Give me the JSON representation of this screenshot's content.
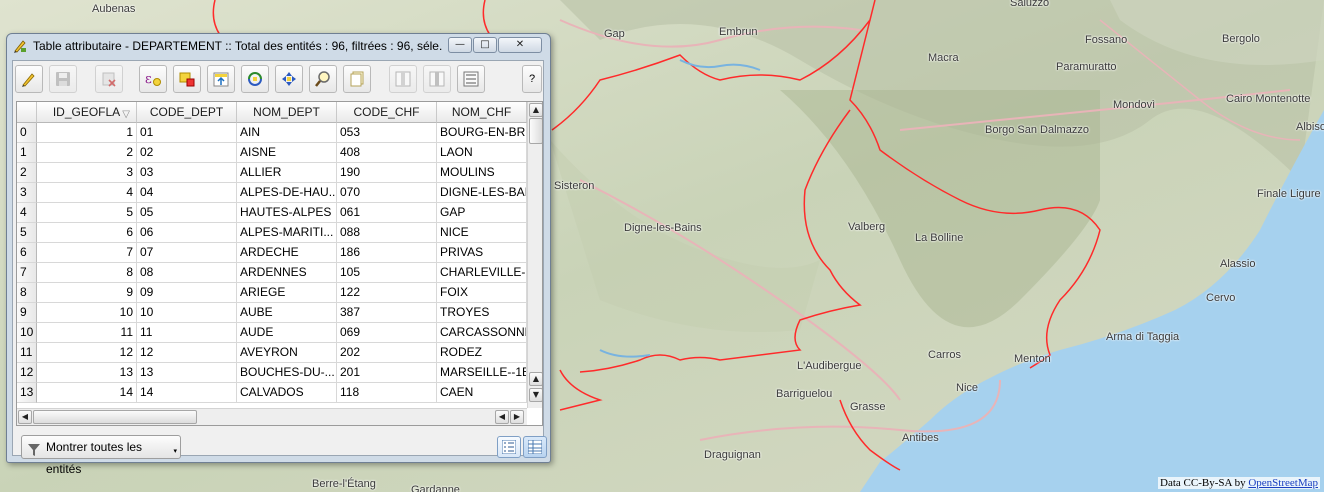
{
  "window": {
    "title": "Table attributaire - DEPARTEMENT :: Total des entités : 96, filtrées : 96, séle...",
    "controls": {
      "minimize": "—",
      "maximize": "□",
      "close": "✕"
    }
  },
  "toolbar": {
    "buttons": [
      "edit-pencil-icon",
      "save-icon",
      "delete-icon",
      "expression-select-icon",
      "deselect-icon",
      "move-selection-top-icon",
      "invert-selection-icon",
      "pan-to-selection-icon",
      "zoom-to-selection-icon",
      "copy-icon",
      "new-field-icon",
      "delete-field-icon",
      "field-calculator-icon"
    ],
    "help_label": "?"
  },
  "table": {
    "columns": [
      "ID_GEOFLA",
      "CODE_DEPT",
      "NOM_DEPT",
      "CODE_CHF",
      "NOM_CHF"
    ],
    "sort_indicator": "▽",
    "rows": [
      {
        "idx": "0",
        "id": "1",
        "code": "01",
        "nom": "AIN",
        "chf": "053",
        "nomchf": "BOURG-EN-BR..."
      },
      {
        "idx": "1",
        "id": "2",
        "code": "02",
        "nom": "AISNE",
        "chf": "408",
        "nomchf": "LAON"
      },
      {
        "idx": "2",
        "id": "3",
        "code": "03",
        "nom": "ALLIER",
        "chf": "190",
        "nomchf": "MOULINS"
      },
      {
        "idx": "3",
        "id": "4",
        "code": "04",
        "nom": "ALPES-DE-HAU...",
        "chf": "070",
        "nomchf": "DIGNE-LES-BAI..."
      },
      {
        "idx": "4",
        "id": "5",
        "code": "05",
        "nom": "HAUTES-ALPES",
        "chf": "061",
        "nomchf": "GAP"
      },
      {
        "idx": "5",
        "id": "6",
        "code": "06",
        "nom": "ALPES-MARITI...",
        "chf": "088",
        "nomchf": "NICE"
      },
      {
        "idx": "6",
        "id": "7",
        "code": "07",
        "nom": "ARDECHE",
        "chf": "186",
        "nomchf": "PRIVAS"
      },
      {
        "idx": "7",
        "id": "8",
        "code": "08",
        "nom": "ARDENNES",
        "chf": "105",
        "nomchf": "CHARLEVILLE-..."
      },
      {
        "idx": "8",
        "id": "9",
        "code": "09",
        "nom": "ARIEGE",
        "chf": "122",
        "nomchf": "FOIX"
      },
      {
        "idx": "9",
        "id": "10",
        "code": "10",
        "nom": "AUBE",
        "chf": "387",
        "nomchf": "TROYES"
      },
      {
        "idx": "10",
        "id": "11",
        "code": "11",
        "nom": "AUDE",
        "chf": "069",
        "nomchf": "CARCASSONNE"
      },
      {
        "idx": "11",
        "id": "12",
        "code": "12",
        "nom": "AVEYRON",
        "chf": "202",
        "nomchf": "RODEZ"
      },
      {
        "idx": "12",
        "id": "13",
        "code": "13",
        "nom": "BOUCHES-DU-...",
        "chf": "201",
        "nomchf": "MARSEILLE--1E..."
      },
      {
        "idx": "13",
        "id": "14",
        "code": "14",
        "nom": "CALVADOS",
        "chf": "118",
        "nomchf": "CAEN"
      }
    ]
  },
  "scroll": {
    "up": "▲",
    "down": "▼",
    "left": "◀",
    "right": "▶"
  },
  "bottom": {
    "filter_label": "Montrer toutes les entités",
    "caret": "▾"
  },
  "map": {
    "places": [
      {
        "name": "Aubenas"
      },
      {
        "name": "Gap"
      },
      {
        "name": "Embrun"
      },
      {
        "name": "Saluzzo"
      },
      {
        "name": "Fossano"
      },
      {
        "name": "Bergolo"
      },
      {
        "name": "Macra"
      },
      {
        "name": "Paramuratto"
      },
      {
        "name": "Mondovì"
      },
      {
        "name": "Cairo Montenotte"
      },
      {
        "name": "Borgo San Dalmazzo"
      },
      {
        "name": "Albiso"
      },
      {
        "name": "Sisteron"
      },
      {
        "name": "Finale Ligure"
      },
      {
        "name": "Digne-les-Bains"
      },
      {
        "name": "Valberg"
      },
      {
        "name": "La Bolline"
      },
      {
        "name": "Alassio"
      },
      {
        "name": "Cervo"
      },
      {
        "name": "Arma di Taggia"
      },
      {
        "name": "Carros"
      },
      {
        "name": "Menton"
      },
      {
        "name": "L'Audibergue"
      },
      {
        "name": "Nice"
      },
      {
        "name": "Barriguelou"
      },
      {
        "name": "Grasse"
      },
      {
        "name": "Antibes"
      },
      {
        "name": "Draguignan"
      },
      {
        "name": "Berre-l'Étang"
      },
      {
        "name": "Gardanne"
      }
    ],
    "attribution_text": "Data CC-By-SA by ",
    "attribution_link": "OpenStreetMap",
    "colors": {
      "land": "#e6e2d3",
      "sea": "#a6d1ee",
      "border": "#ff2a2a",
      "road": "#e8b4b8"
    }
  }
}
